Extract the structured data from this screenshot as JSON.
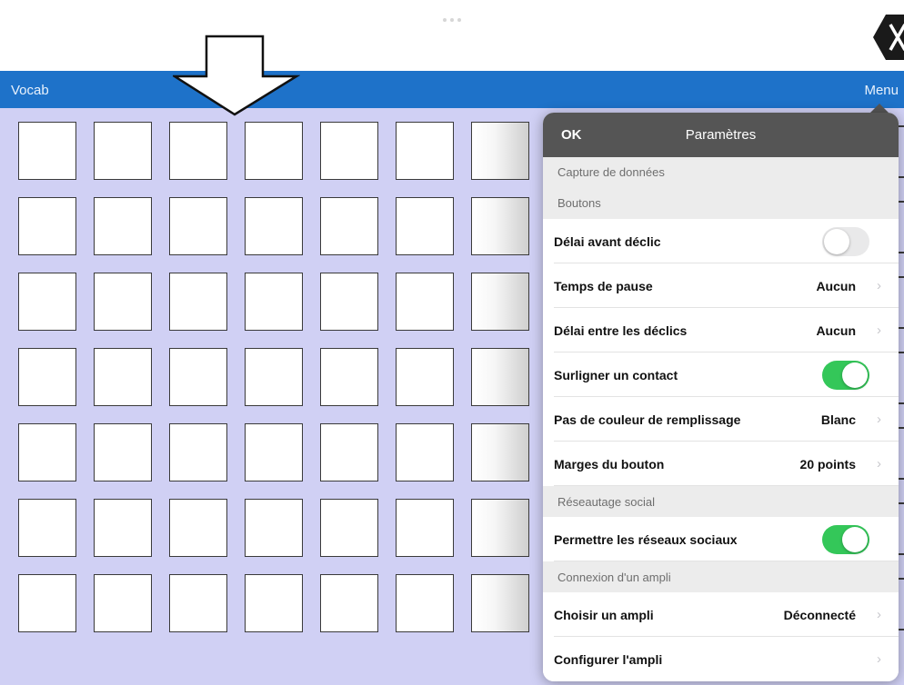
{
  "navbar": {
    "vocab_label": "Vocab",
    "menu_label": "Menu",
    "color": "#1e72c9"
  },
  "icons": {
    "close": "close-x-icon",
    "arrow": "down-arrow-icon",
    "chevron": "chevron-right-icon"
  },
  "grid": {
    "rows": 7,
    "cols": 7,
    "background": "#d0d0f4"
  },
  "settings": {
    "ok_label": "OK",
    "title": "Paramètres",
    "chevron": "›",
    "sections": [
      {
        "header": "Capture de données",
        "rows": []
      },
      {
        "header": "Boutons",
        "rows": [
          {
            "label": "Délai avant déclic",
            "type": "toggle",
            "on": false
          },
          {
            "label": "Temps de pause",
            "type": "value",
            "value": "Aucun"
          },
          {
            "label": "Délai entre les déclics",
            "type": "value",
            "value": "Aucun"
          },
          {
            "label": "Surligner un contact",
            "type": "toggle",
            "on": true
          },
          {
            "label": "Pas de couleur de remplissage",
            "type": "value",
            "value": "Blanc"
          },
          {
            "label": "Marges du bouton",
            "type": "value",
            "value": "20 points"
          }
        ]
      },
      {
        "header": "Réseautage social",
        "rows": [
          {
            "label": "Permettre les réseaux sociaux",
            "type": "toggle",
            "on": true
          }
        ]
      },
      {
        "header": "Connexion d'un ampli",
        "rows": [
          {
            "label": "Choisir un ampli",
            "type": "value",
            "value": "Déconnecté"
          },
          {
            "label": "Configurer l'ampli",
            "type": "value",
            "value": ""
          }
        ]
      }
    ]
  },
  "colors": {
    "toggle_on": "#34c759",
    "toggle_off": "#e9e9ea",
    "popover_header": "#555555"
  }
}
